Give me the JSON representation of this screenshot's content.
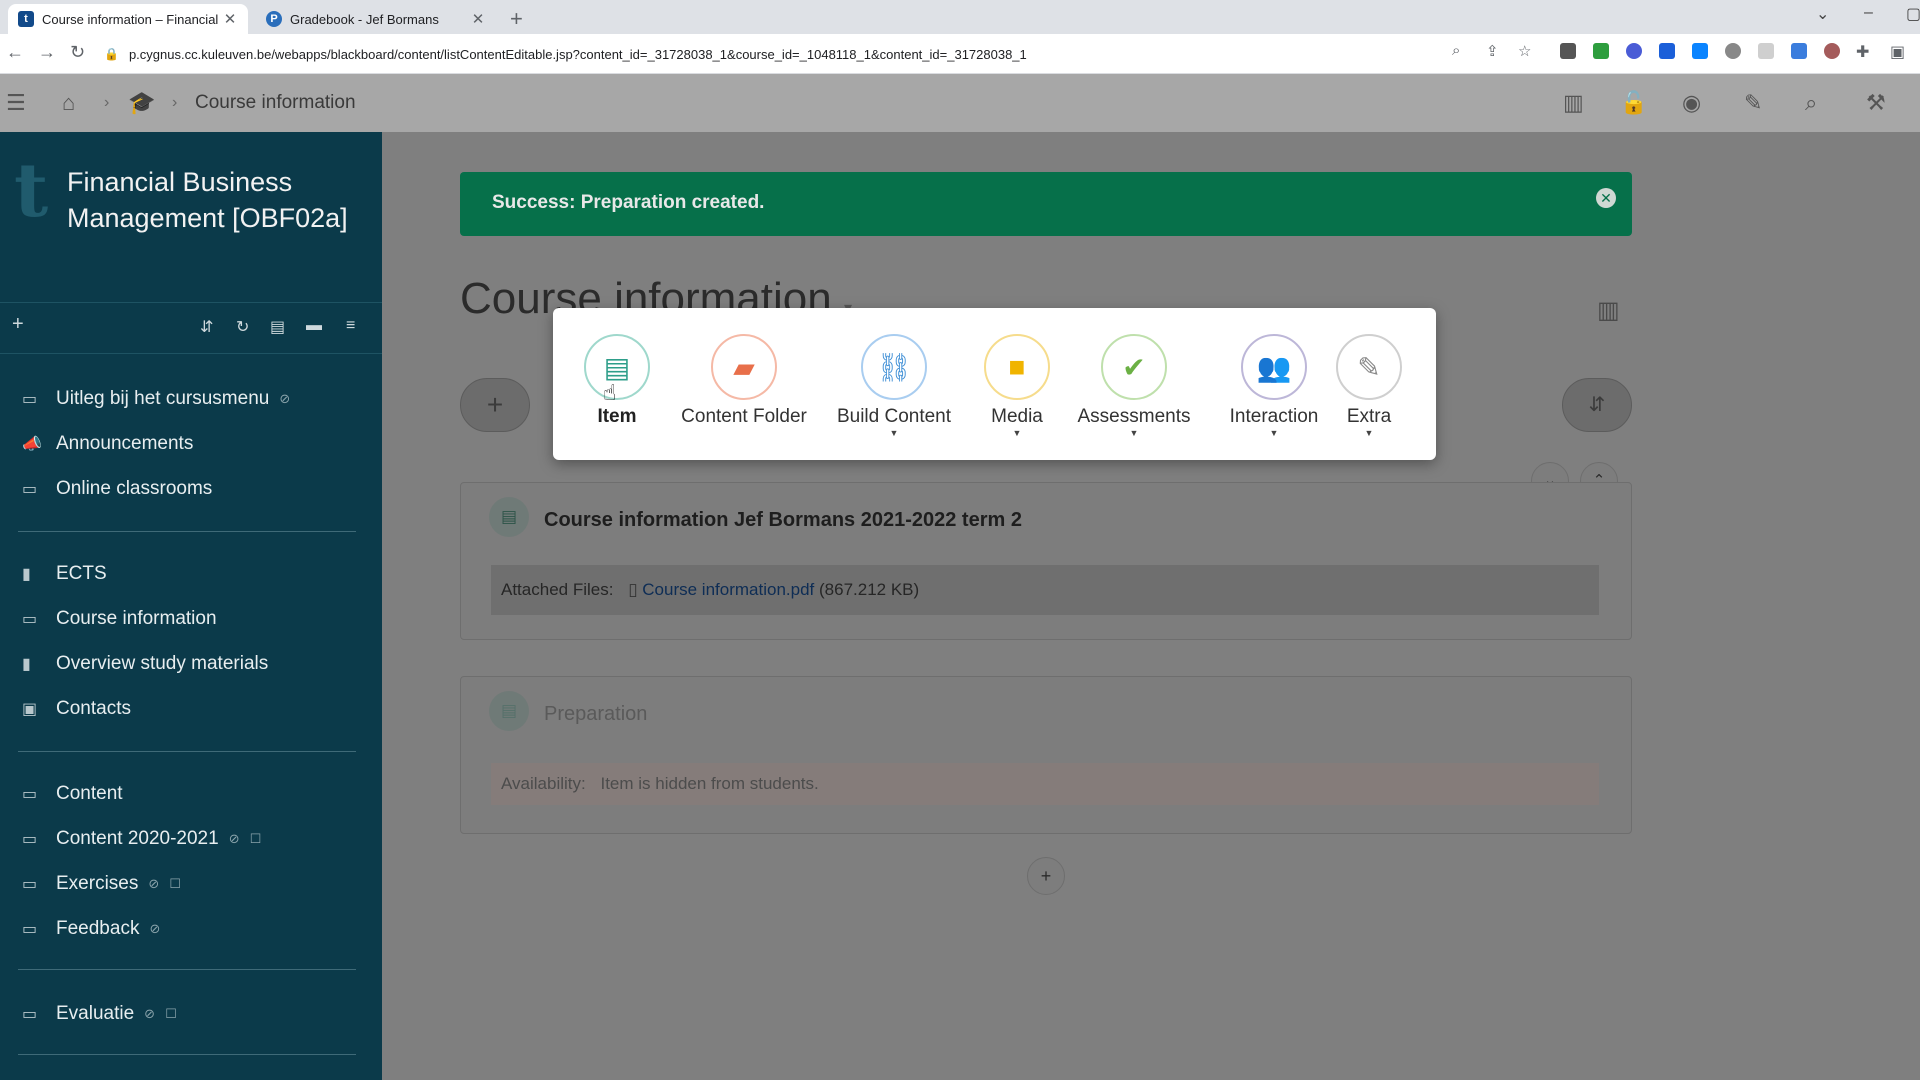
{
  "browser": {
    "tabs": [
      {
        "title": "Course information – Financial B",
        "favicon": "t",
        "active": true
      },
      {
        "title": "Gradebook - Jef Bormans",
        "favicon": "P",
        "active": false
      }
    ],
    "new_tab": "+",
    "url": "p.cygnus.cc.kuleuven.be/webapps/blackboard/content/listContentEditable.jsp?content_id=_31728038_1&course_id=_1048118_1&content_id=_31728038_1"
  },
  "header": {
    "breadcrumb_current": "Course information"
  },
  "sidebar": {
    "course_logo": "t",
    "course_title": "Financial Business Management [OBF02a]",
    "tools_add": "+",
    "groups": [
      [
        {
          "label": "Uitleg bij het cursusmenu",
          "icon": "folder-icon",
          "hidden": true,
          "unavailable": false
        },
        {
          "label": "Announcements",
          "icon": "megaphone-icon",
          "hidden": false,
          "unavailable": false
        },
        {
          "label": "Online classrooms",
          "icon": "folder-icon",
          "hidden": false,
          "unavailable": false
        }
      ],
      [
        {
          "label": "ECTS",
          "icon": "book-icon",
          "hidden": false,
          "unavailable": false
        },
        {
          "label": "Course information",
          "icon": "folder-icon",
          "hidden": false,
          "unavailable": false
        },
        {
          "label": "Overview study materials",
          "icon": "book-icon",
          "hidden": false,
          "unavailable": false
        },
        {
          "label": "Contacts",
          "icon": "contact-card-icon",
          "hidden": false,
          "unavailable": false
        }
      ],
      [
        {
          "label": "Content",
          "icon": "folder-icon",
          "hidden": false,
          "unavailable": false
        },
        {
          "label": "Content 2020-2021",
          "icon": "folder-icon",
          "hidden": true,
          "unavailable": true
        },
        {
          "label": "Exercises",
          "icon": "folder-icon",
          "hidden": true,
          "unavailable": true
        },
        {
          "label": "Feedback",
          "icon": "folder-icon",
          "hidden": true,
          "unavailable": false
        }
      ],
      [
        {
          "label": "Evaluatie",
          "icon": "folder-icon",
          "hidden": true,
          "unavailable": true
        }
      ]
    ]
  },
  "main": {
    "success_message": "Success: Preparation created.",
    "page_title": "Course information",
    "add_button": "+",
    "items": [
      {
        "title": "Course information Jef Bormans 2021-2022 term 2",
        "attached_label": "Attached Files:",
        "file_name": "Course information.pdf",
        "file_size": "(867.212 KB)"
      },
      {
        "title": "Preparation",
        "availability_label": "Availability:",
        "availability_value": "Item is hidden from students."
      }
    ],
    "bottom_add": "+"
  },
  "popup": {
    "items": [
      {
        "label": "Item",
        "icon": "document-icon",
        "color": "#2e9e8a",
        "dropdown": false
      },
      {
        "label": "Content Folder",
        "icon": "folder-open-icon",
        "color": "#e86f4a",
        "dropdown": false
      },
      {
        "label": "Build Content",
        "icon": "link-icon",
        "color": "#3f8fd6",
        "dropdown": true
      },
      {
        "label": "Media",
        "icon": "video-camera-icon",
        "color": "#f0b400",
        "dropdown": true
      },
      {
        "label": "Assessments",
        "icon": "checklist-icon",
        "color": "#6bb044",
        "dropdown": true
      },
      {
        "label": "Interaction",
        "icon": "people-icon",
        "color": "#5b4f9a",
        "dropdown": true
      },
      {
        "label": "Extra",
        "icon": "edit-icon",
        "color": "#8a8a8a",
        "dropdown": true
      }
    ]
  },
  "colors": {
    "sidebar_bg": "#0b3a4a",
    "success_bg": "#06704a",
    "overlay": "#7f7f7f"
  }
}
